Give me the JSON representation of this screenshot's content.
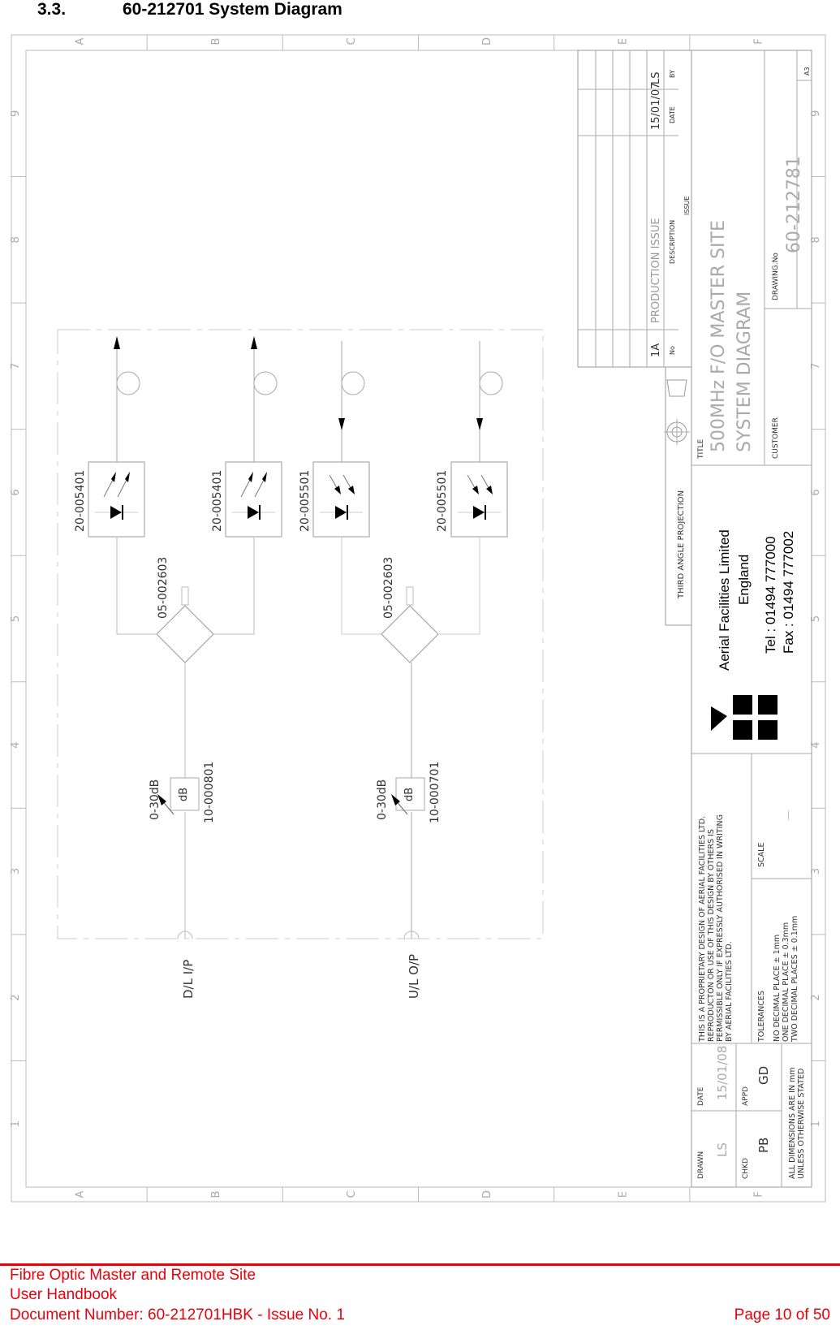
{
  "section": {
    "number": "3.3.",
    "title": "60-212701 System Diagram"
  },
  "drawing": {
    "border_columns": [
      "A",
      "B",
      "C",
      "D",
      "E",
      "F"
    ],
    "border_rows": [
      "1",
      "2",
      "3",
      "4",
      "5",
      "6",
      "7",
      "8",
      "9"
    ],
    "circuit": {
      "downlink_input_label": "D/L I/P",
      "uplink_output_label": "U/L O/P",
      "attenuators": [
        {
          "range": "0-30dB",
          "symbol": "dB",
          "part": "10-000801"
        },
        {
          "range": "0-30dB",
          "symbol": "dB",
          "part": "10-000701"
        }
      ],
      "splitters": [
        {
          "part": "05-002603"
        },
        {
          "part": "05-002603"
        }
      ],
      "optical_modules": [
        {
          "part": "20-005401",
          "type": "transmitter",
          "direction": "out"
        },
        {
          "part": "20-005401",
          "type": "transmitter",
          "direction": "out"
        },
        {
          "part": "20-005501",
          "type": "receiver",
          "direction": "in"
        },
        {
          "part": "20-005501",
          "type": "receiver",
          "direction": "in"
        }
      ]
    },
    "revisions": {
      "headers": {
        "no": "No",
        "description": "DESCRIPTION",
        "date": "DATE",
        "by": "BY",
        "issue": "ISSUE"
      },
      "rows": [
        {
          "no": "1A",
          "description": "PRODUCTION ISSUE",
          "date": "15/01/07",
          "by": "LS"
        }
      ]
    },
    "projection_label": "THIRD ANGLE PROJECTION",
    "title_block": {
      "title_label": "TITLE",
      "title_line1": "500MHz F/O MASTER SITE",
      "title_line2": "SYSTEM DIAGRAM",
      "customer_label": "CUSTOMER",
      "drawing_no_label": "DRAWING.No",
      "drawing_no": "60-212781",
      "sheet_size": "A3"
    },
    "company": {
      "name": "Aerial Facilities Limited",
      "country": "England",
      "tel": "Tel : 01494 777000",
      "fax": "Fax : 01494 777002"
    },
    "proprietary_notice": [
      "THIS IS A PROPRIETARY DESIGN OF AERIAL FACILITIES LTD.",
      "REPRODUCTON OR USE OF THIS DESIGN BY OTHERS IS",
      "PERMISSIBLE ONLY IF EXPRESSLY AUTHORISED IN WRITING",
      "BY AERIAL FACILITIES LTD."
    ],
    "tolerances": {
      "label": "TOLERANCES",
      "lines": [
        "NO DECIMAL PLACE ± 1mm",
        "ONE DECIMAL PLACE ± 0.3mm",
        "TWO DECIMAL PLACES ± 0.1mm"
      ]
    },
    "scale": {
      "label": "SCALE",
      "value": "—"
    },
    "approvals": {
      "drawn_label": "DRAWN",
      "drawn": "LS",
      "date_label": "DATE",
      "date": "15/01/08",
      "chkd_label": "CHKD",
      "chkd": "PB",
      "appd_label": "APPD",
      "appd": "GD"
    },
    "dimensions_note": [
      "ALL DIMENSIONS ARE IN mm",
      "UNLESS OTHERWISE STATED"
    ]
  },
  "footer": {
    "line1": "Fibre Optic Master and Remote Site",
    "line2": "User Handbook",
    "line3": "Document Number: 60-212701HBK - Issue No. 1",
    "page": "Page 10 of 50",
    "color": "#e8000b"
  }
}
